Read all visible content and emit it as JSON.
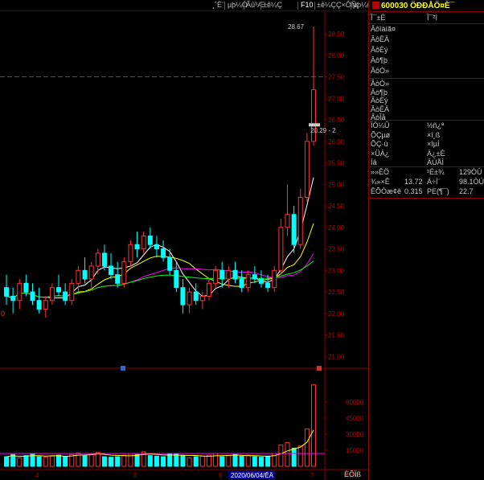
{
  "toolbar": {
    "items": [
      "¸´È¨",
      "µþ¼Ó",
      "Ãû³Æ",
      "±ê¼Ç",
      "F10",
      "±ê¼ÇÇ×ÔÑ¡",
      "µþ¼Ø"
    ]
  },
  "chart_data": {
    "type": "candlestick",
    "price_axis": {
      "ticks": [
        "28.50",
        "28.00",
        "27.50",
        "27.00",
        "26.50",
        "26.00",
        "25.50",
        "25.00",
        "24.50",
        "24.00",
        "23.50",
        "23.00",
        "22.50",
        "22.00",
        "21.50",
        "21.00"
      ],
      "min": 20.8,
      "max": 28.8
    },
    "volume_axis": {
      "ticks": [
        "60000",
        "45000",
        "30000",
        "15000"
      ],
      "unit": "X100",
      "max": 78000
    },
    "date_ticks": [
      "4",
      "5",
      "6",
      "7"
    ],
    "crosshair_date": "2020/06/04/ËÄ",
    "annotations": {
      "high": "28.67",
      "low": "20.29 - 2",
      "left_edge": "0"
    },
    "candles": [
      {
        "o": 22.6,
        "h": 22.9,
        "l": 22.2,
        "c": 22.4
      },
      {
        "o": 22.4,
        "h": 22.6,
        "l": 22.0,
        "c": 22.3
      },
      {
        "o": 22.3,
        "h": 22.8,
        "l": 22.1,
        "c": 22.7
      },
      {
        "o": 22.7,
        "h": 22.9,
        "l": 22.4,
        "c": 22.5
      },
      {
        "o": 22.5,
        "h": 22.7,
        "l": 22.2,
        "c": 22.3
      },
      {
        "o": 22.3,
        "h": 22.6,
        "l": 22.0,
        "c": 22.1
      },
      {
        "o": 22.1,
        "h": 22.4,
        "l": 21.9,
        "c": 22.3
      },
      {
        "o": 22.3,
        "h": 22.7,
        "l": 22.2,
        "c": 22.6
      },
      {
        "o": 22.6,
        "h": 22.9,
        "l": 22.4,
        "c": 22.5
      },
      {
        "o": 22.5,
        "h": 22.7,
        "l": 22.2,
        "c": 22.3
      },
      {
        "o": 22.3,
        "h": 22.8,
        "l": 22.2,
        "c": 22.7
      },
      {
        "o": 22.7,
        "h": 23.1,
        "l": 22.5,
        "c": 23.0
      },
      {
        "o": 23.0,
        "h": 23.3,
        "l": 22.7,
        "c": 22.8
      },
      {
        "o": 22.8,
        "h": 23.2,
        "l": 22.6,
        "c": 23.1
      },
      {
        "o": 23.1,
        "h": 23.5,
        "l": 22.9,
        "c": 23.4
      },
      {
        "o": 23.4,
        "h": 23.6,
        "l": 23.0,
        "c": 23.1
      },
      {
        "o": 23.1,
        "h": 23.4,
        "l": 22.8,
        "c": 22.9
      },
      {
        "o": 22.9,
        "h": 23.2,
        "l": 22.6,
        "c": 22.7
      },
      {
        "o": 22.7,
        "h": 23.3,
        "l": 22.6,
        "c": 23.2
      },
      {
        "o": 23.2,
        "h": 23.7,
        "l": 23.1,
        "c": 23.6
      },
      {
        "o": 23.6,
        "h": 23.9,
        "l": 23.3,
        "c": 23.5
      },
      {
        "o": 23.5,
        "h": 23.9,
        "l": 23.4,
        "c": 23.8
      },
      {
        "o": 23.8,
        "h": 24.0,
        "l": 23.5,
        "c": 23.6
      },
      {
        "o": 23.6,
        "h": 23.8,
        "l": 23.3,
        "c": 23.5
      },
      {
        "o": 23.5,
        "h": 23.7,
        "l": 23.2,
        "c": 23.3
      },
      {
        "o": 23.3,
        "h": 23.5,
        "l": 22.9,
        "c": 23.0
      },
      {
        "o": 23.0,
        "h": 23.2,
        "l": 22.5,
        "c": 22.6
      },
      {
        "o": 22.6,
        "h": 22.8,
        "l": 22.0,
        "c": 22.2
      },
      {
        "o": 22.2,
        "h": 22.6,
        "l": 22.0,
        "c": 22.5
      },
      {
        "o": 22.5,
        "h": 22.7,
        "l": 22.2,
        "c": 22.3
      },
      {
        "o": 22.3,
        "h": 22.5,
        "l": 22.1,
        "c": 22.4
      },
      {
        "o": 22.4,
        "h": 22.8,
        "l": 22.3,
        "c": 22.7
      },
      {
        "o": 22.7,
        "h": 23.1,
        "l": 22.6,
        "c": 23.0
      },
      {
        "o": 23.0,
        "h": 23.2,
        "l": 22.6,
        "c": 22.8
      },
      {
        "o": 22.8,
        "h": 23.1,
        "l": 22.6,
        "c": 23.0
      },
      {
        "o": 23.0,
        "h": 23.2,
        "l": 22.7,
        "c": 22.8
      },
      {
        "o": 22.8,
        "h": 23.0,
        "l": 22.5,
        "c": 22.6
      },
      {
        "o": 22.6,
        "h": 23.0,
        "l": 22.5,
        "c": 22.9
      },
      {
        "o": 22.9,
        "h": 23.1,
        "l": 22.7,
        "c": 22.8
      },
      {
        "o": 22.8,
        "h": 23.0,
        "l": 22.6,
        "c": 22.7
      },
      {
        "o": 22.7,
        "h": 22.9,
        "l": 22.5,
        "c": 22.6
      },
      {
        "o": 22.6,
        "h": 23.1,
        "l": 22.5,
        "c": 23.0
      },
      {
        "o": 23.0,
        "h": 24.2,
        "l": 22.9,
        "c": 24.0
      },
      {
        "o": 24.0,
        "h": 25.0,
        "l": 23.8,
        "c": 24.3
      },
      {
        "o": 24.3,
        "h": 24.5,
        "l": 23.4,
        "c": 23.6
      },
      {
        "o": 23.6,
        "h": 24.9,
        "l": 23.5,
        "c": 24.7
      },
      {
        "o": 24.7,
        "h": 26.2,
        "l": 24.6,
        "c": 26.0
      },
      {
        "o": 26.0,
        "h": 28.67,
        "l": 25.9,
        "c": 27.2
      }
    ],
    "volumes": [
      9000,
      11000,
      8000,
      10000,
      12000,
      9000,
      8500,
      9500,
      10500,
      9000,
      11000,
      12500,
      10000,
      11500,
      13000,
      9000,
      8500,
      9000,
      10500,
      12000,
      11000,
      13500,
      10000,
      9500,
      9000,
      11500,
      12000,
      10000,
      8000,
      9000,
      9500,
      10500,
      12000,
      9000,
      10000,
      11000,
      9500,
      10500,
      9000,
      8500,
      9500,
      12000,
      20000,
      22000,
      17000,
      19000,
      35000,
      76000
    ],
    "ma": {
      "ma5": {
        "color": "#ffffff"
      },
      "ma10": {
        "color": "#ffff00"
      },
      "ma20": {
        "color": "#ff00ff"
      },
      "ma60": {
        "color": "#00ff00"
      }
    },
    "colors": {
      "up": "#ff3333",
      "down": "#00ffff",
      "grid": "#8b0000"
    }
  },
  "side_panel": {
    "code_title": "600030 ÖÐÐÅÖ¤È¯",
    "header_left": "Î¯±È",
    "header_right": "Î¯²î",
    "sell_rows": [
      "Âôîàìã¤",
      "ÂôËÄ",
      "ÂôÈý",
      "Âô¶þ",
      "ÂôÒ»"
    ],
    "buy_rows": [
      "ÂòÒ»",
      "Âò¶þ",
      "ÂòÈý",
      "ÂòËÄ",
      "ÂòÎå"
    ],
    "stats_left": [
      "ÏÖ¼Û",
      "ÕÇµø",
      "ÕÇ·ù",
      "×ÜÁ¿",
      "Íâ"
    ],
    "stats_right": [
      "½ñ¿ª",
      "×î¸ß",
      "×îµÍ",
      "Á¿±È",
      "ÄÚÅÌ"
    ],
    "fin": [
      {
        "label": "»»ÊÖ",
        "value": "",
        "label2": "¹É±¾",
        "value2": "129ÒÚ"
      },
      {
        "label": "¾»×Ê",
        "value": "13.72",
        "label2": "Á÷Í¨",
        "value2": "98.1ÒÚ"
      },
      {
        "label": "ÊÕÒæ¢ê",
        "value": "0.315",
        "label2": "PE(¶¯)",
        "value2": "22.7"
      }
    ],
    "bottom_label": "ÈÕÏß"
  }
}
